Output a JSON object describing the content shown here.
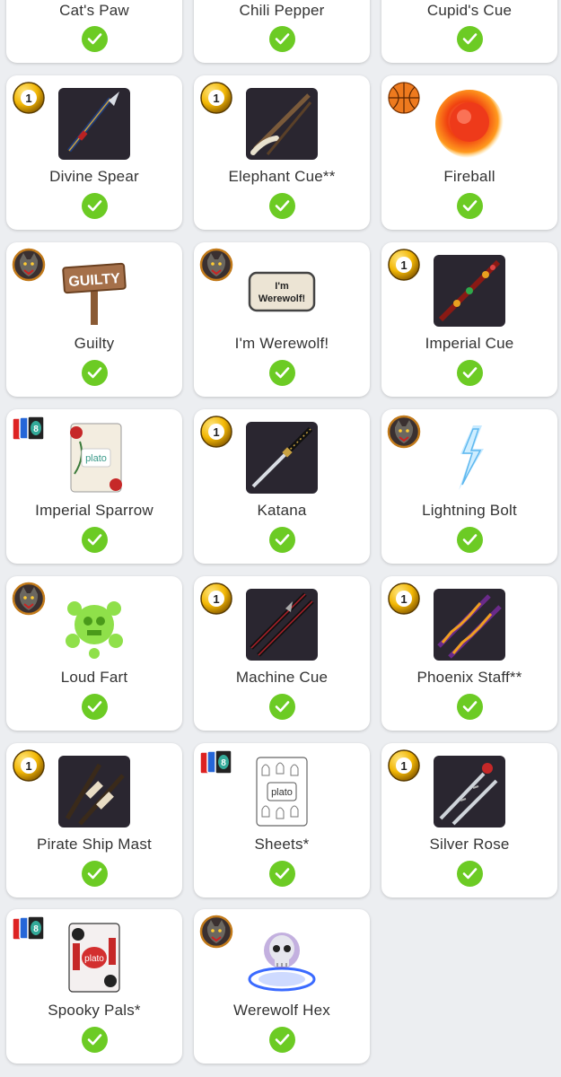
{
  "items": [
    {
      "name": "Cat's Paw",
      "badge": "none",
      "art": "none"
    },
    {
      "name": "Chili Pepper",
      "badge": "none",
      "art": "none"
    },
    {
      "name": "Cupid's Cue",
      "badge": "none",
      "art": "none"
    },
    {
      "name": "Divine Spear",
      "badge": "pool-ball-1",
      "art": "spear"
    },
    {
      "name": "Elephant Cue**",
      "badge": "pool-ball-1",
      "art": "cue-tusk"
    },
    {
      "name": "Fireball",
      "badge": "basketball",
      "art": "fireball"
    },
    {
      "name": "Guilty",
      "badge": "werewolf",
      "art": "guilty-sign"
    },
    {
      "name": "I'm Werewolf!",
      "badge": "werewolf",
      "art": "werewolf-sign"
    },
    {
      "name": "Imperial Cue",
      "badge": "pool-ball-1",
      "art": "cue-jeweled"
    },
    {
      "name": "Imperial Sparrow",
      "badge": "uno-cards",
      "art": "card-sparrow"
    },
    {
      "name": "Katana",
      "badge": "pool-ball-1",
      "art": "katana"
    },
    {
      "name": "Lightning Bolt",
      "badge": "werewolf",
      "art": "lightning"
    },
    {
      "name": "Loud Fart",
      "badge": "werewolf",
      "art": "fart-cloud"
    },
    {
      "name": "Machine Cue",
      "badge": "pool-ball-1",
      "art": "cue-machine"
    },
    {
      "name": "Phoenix Staff**",
      "badge": "pool-ball-1",
      "art": "cue-phoenix"
    },
    {
      "name": "Pirate Ship Mast",
      "badge": "pool-ball-1",
      "art": "cue-mast"
    },
    {
      "name": "Sheets*",
      "badge": "uno-cards",
      "art": "card-sheets"
    },
    {
      "name": "Silver Rose",
      "badge": "pool-ball-1",
      "art": "cue-rose"
    },
    {
      "name": "Spooky Pals*",
      "badge": "uno-cards",
      "art": "card-spooky"
    },
    {
      "name": "Werewolf Hex",
      "badge": "werewolf",
      "art": "skull-hex"
    }
  ],
  "card_label_text": {
    "card_text": "plato",
    "sign_guilty": "GUILTY",
    "sign_werewolf": "I'm Werewolf!"
  },
  "colors": {
    "check_green": "#6ccb24",
    "page_bg": "#eceef1",
    "ball_yellow": "#f2b705"
  }
}
